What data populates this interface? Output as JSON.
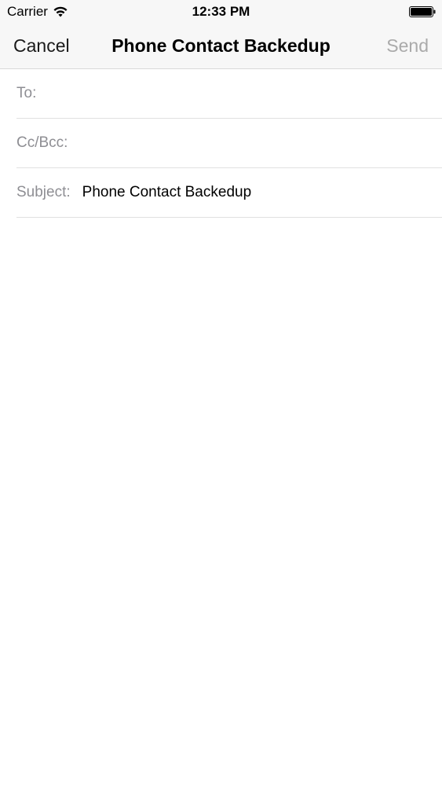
{
  "status_bar": {
    "carrier": "Carrier",
    "time": "12:33 PM",
    "icons": [
      "wifi-icon",
      "battery-icon"
    ]
  },
  "nav": {
    "cancel_label": "Cancel",
    "title": "Phone Contact Backedup",
    "send_label": "Send"
  },
  "form": {
    "to": {
      "label": "To:",
      "value": ""
    },
    "cc_bcc": {
      "label": "Cc/Bcc:",
      "value": ""
    },
    "subject": {
      "label": "Subject:",
      "value": "Phone Contact Backedup"
    },
    "body": {
      "value": ""
    }
  },
  "colors": {
    "nav_background": "#f7f7f7",
    "label_gray": "#8e8e93",
    "send_disabled": "#aaaaaa",
    "separator": "#e0e0e0"
  }
}
